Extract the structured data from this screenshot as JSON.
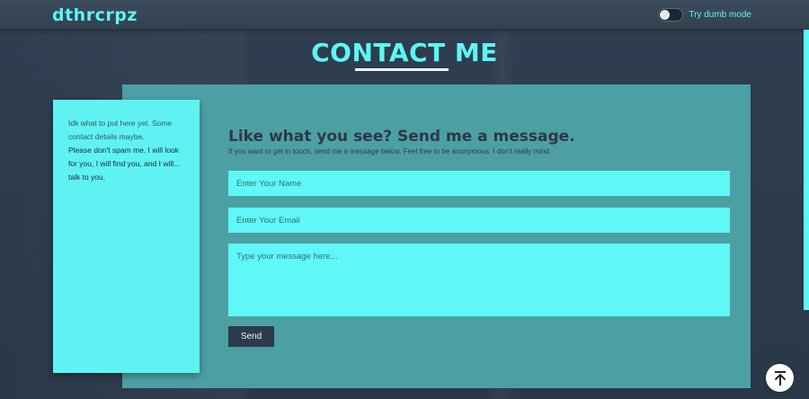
{
  "navbar": {
    "brand": "dthrcrpz",
    "toggle_label": "Try dumb mode",
    "toggle_on": false
  },
  "page": {
    "title": "CONTACT ME"
  },
  "side_card": {
    "line1": "Idk what to put here yet. Some contact details maybe.",
    "line2": "Please don't spam me. I will look for you, I will find you, and I will... talk to you."
  },
  "form": {
    "heading": "Like what you see? Send me a message.",
    "subheading": "If you want to get in touch, send me a message below. Feel free to be anonymous. I don't really mind.",
    "name_placeholder": "Enter Your Name",
    "email_placeholder": "Enter Your Email",
    "message_placeholder": "Type your message here...",
    "send_label": "Send"
  },
  "icons": {
    "scroll_top": "arrow-up-icon"
  },
  "colors": {
    "accent": "#5cf6f6",
    "panel": "#4ca0a4",
    "background": "#2b3a4c"
  }
}
